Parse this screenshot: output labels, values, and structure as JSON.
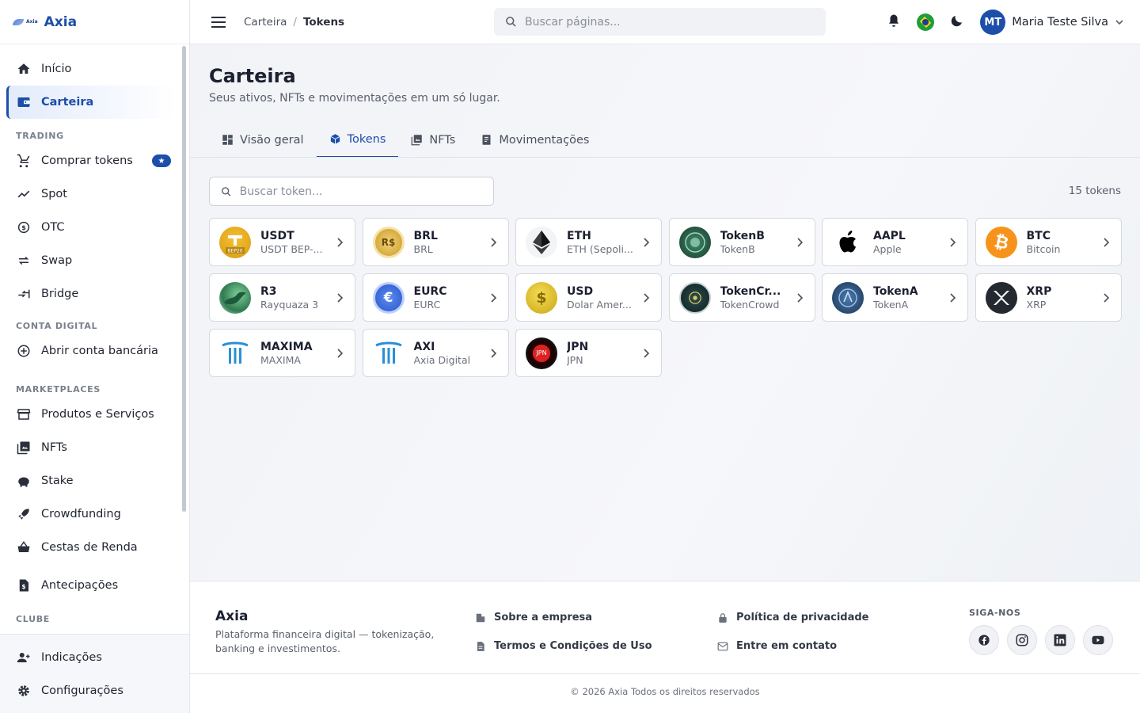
{
  "brand": {
    "mini_text": "Axia",
    "name": "Axia"
  },
  "sidebar": {
    "items": [
      {
        "label": "Início",
        "icon": "home-icon"
      },
      {
        "label": "Carteira",
        "icon": "wallet-icon",
        "active": true
      }
    ],
    "trading_title": "TRADING",
    "trading": [
      {
        "label": "Comprar tokens",
        "icon": "cart-icon",
        "badge": "★"
      },
      {
        "label": "Spot",
        "icon": "chart-line-icon"
      },
      {
        "label": "OTC",
        "icon": "currency-exchange-icon"
      },
      {
        "label": "Swap",
        "icon": "swap-icon"
      },
      {
        "label": "Bridge",
        "icon": "bridge-icon"
      }
    ],
    "conta_title": "CONTA DIGITAL",
    "conta": [
      {
        "label": "Abrir conta bancária",
        "icon": "add-circle-icon"
      }
    ],
    "market_title": "MARKETPLACES",
    "market": [
      {
        "label": "Produtos e Serviços",
        "icon": "store-icon"
      },
      {
        "label": "NFTs",
        "icon": "image-icon"
      },
      {
        "label": "Stake",
        "icon": "piggy-bank-icon"
      },
      {
        "label": "Crowdfunding",
        "icon": "rocket-icon"
      },
      {
        "label": "Cestas de Renda",
        "icon": "basket-icon"
      }
    ],
    "antecipacoes": {
      "label": "Antecipações",
      "icon": "invoice-icon"
    },
    "clube_title": "CLUBE",
    "bottom": [
      {
        "label": "Indicações",
        "icon": "person-add-icon"
      },
      {
        "label": "Configurações",
        "icon": "gear-icon"
      }
    ]
  },
  "header": {
    "breadcrumb": [
      "Carteira",
      "/",
      "Tokens"
    ],
    "search_placeholder": "Buscar páginas...",
    "user_initials": "MT",
    "user_name": "Maria Teste Silva"
  },
  "main": {
    "title": "Carteira",
    "subtitle": "Seus ativos, NFTs e movimentações em um só lugar.",
    "tabs": [
      {
        "label": "Visão geral",
        "icon": "dashboard-icon"
      },
      {
        "label": "Tokens",
        "icon": "cube-icon",
        "active": true
      },
      {
        "label": "NFTs",
        "icon": "image-icon"
      },
      {
        "label": "Movimentações",
        "icon": "receipt-icon"
      }
    ],
    "token_search_placeholder": "Buscar token...",
    "token_count": "15 tokens",
    "tokens": [
      {
        "symbol": "USDT",
        "name": "USDT BEP-...",
        "coin": "usdt",
        "icon_text": "BEP20"
      },
      {
        "symbol": "BRL",
        "name": "BRL",
        "coin": "brl",
        "icon_text": "R$"
      },
      {
        "symbol": "ETH",
        "name": "ETH (Sepoli...",
        "coin": "eth"
      },
      {
        "symbol": "TokenB",
        "name": "TokenB",
        "coin": "tokenb"
      },
      {
        "symbol": "AAPL",
        "name": "Apple",
        "coin": "aapl"
      },
      {
        "symbol": "BTC",
        "name": "Bitcoin",
        "coin": "btc",
        "icon_text": "₿"
      },
      {
        "symbol": "R3",
        "name": "Rayquaza 3",
        "coin": "r3"
      },
      {
        "symbol": "EURC",
        "name": "EURC",
        "coin": "eurc",
        "icon_text": "€"
      },
      {
        "symbol": "USD",
        "name": "Dolar Amer...",
        "coin": "usd",
        "icon_text": "$"
      },
      {
        "symbol": "TokenCr...",
        "name": "TokenCrowd",
        "coin": "tokencrowd"
      },
      {
        "symbol": "TokenA",
        "name": "TokenA",
        "coin": "tokena"
      },
      {
        "symbol": "XRP",
        "name": "XRP",
        "coin": "xrp"
      },
      {
        "symbol": "MAXIMA",
        "name": "MAXIMA",
        "coin": "maxima"
      },
      {
        "symbol": "AXI",
        "name": "Axia Digital",
        "coin": "axi"
      },
      {
        "symbol": "JPN",
        "name": "JPN",
        "coin": "jpn",
        "icon_text": "JPN"
      }
    ]
  },
  "footer": {
    "brand": "Axia",
    "description": "Plataforma financeira digital — tokenização, banking e investimentos.",
    "links": [
      {
        "label": "Sobre a empresa",
        "icon": "building-icon"
      },
      {
        "label": "Termos e Condições de Uso",
        "icon": "document-icon"
      },
      {
        "label": "Política de privacidade",
        "icon": "lock-icon"
      },
      {
        "label": "Entre em contato",
        "icon": "mail-icon"
      }
    ],
    "social_title": "SIGA-NOS",
    "social": [
      "facebook-icon",
      "instagram-icon",
      "linkedin-icon",
      "youtube-icon"
    ],
    "copyright": "© 2026 Axia Todos os direitos reservados"
  },
  "colors": {
    "accent": "#1c4eaa",
    "text": "#1f2430",
    "muted": "#5a606b"
  }
}
